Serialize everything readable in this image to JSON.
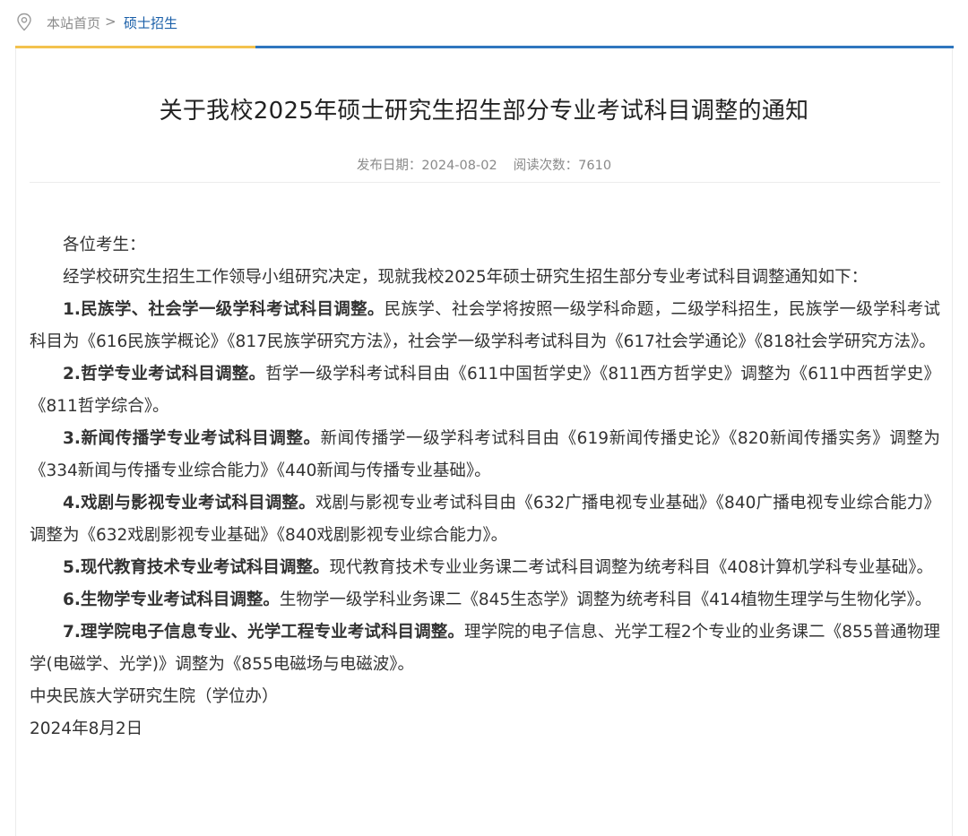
{
  "breadcrumb": {
    "home": "本站首页",
    "separator": ">",
    "current": "硕士招生"
  },
  "article": {
    "title": "关于我校2025年硕士研究生招生部分专业考试科目调整的通知",
    "publish_date": "发布日期：2024-08-02",
    "read_count": "阅读次数：7610",
    "greeting": "各位考生：",
    "intro": "经学校研究生招生工作领导小组研究决定，现就我校2025年硕士研究生招生部分专业考试科目调整通知如下：",
    "items": [
      {
        "heading": "1.民族学、社会学一级学科考试科目调整。",
        "body": "民族学、社会学将按照一级学科命题，二级学科招生，民族学一级学科考试科目为《616民族学概论》《817民族学研究方法》，社会学一级学科考试科目为《617社会学通论》《818社会学研究方法》。"
      },
      {
        "heading": "2.哲学专业考试科目调整。",
        "body": "哲学一级学科考试科目由《611中国哲学史》《811西方哲学史》调整为《611中西哲学史》《811哲学综合》。"
      },
      {
        "heading": "3.新闻传播学专业考试科目调整。",
        "body": "新闻传播学一级学科考试科目由《619新闻传播史论》《820新闻传播实务》调整为《334新闻与传播专业综合能力》《440新闻与传播专业基础》。"
      },
      {
        "heading": "4.戏剧与影视专业考试科目调整。",
        "body": "戏剧与影视专业考试科目由《632广播电视专业基础》《840广播电视专业综合能力》调整为《632戏剧影视专业基础》《840戏剧影视专业综合能力》。"
      },
      {
        "heading": "5.现代教育技术专业考试科目调整。",
        "body": "现代教育技术专业业务课二考试科目调整为统考科目《408计算机学科专业基础》。"
      },
      {
        "heading": "6.生物学专业考试科目调整。",
        "body": "生物学一级学科业务课二《845生态学》调整为统考科目《414植物生理学与生物化学》。"
      },
      {
        "heading": "7.理学院电子信息专业、光学工程专业考试科目调整。",
        "body": "理学院的电子信息、光学工程2个专业的业务课二《855普通物理学(电磁学、光学)》调整为《855电磁场与电磁波》。"
      }
    ],
    "signature": "中央民族大学研究生院（学位办）",
    "sign_date": "2024年8月2日"
  },
  "colors": {
    "accent_blue": "#2f76be",
    "accent_yellow": "#f3c24e",
    "link_blue": "#1a5fa8"
  },
  "icons": {
    "breadcrumb": "location-pin-icon"
  }
}
